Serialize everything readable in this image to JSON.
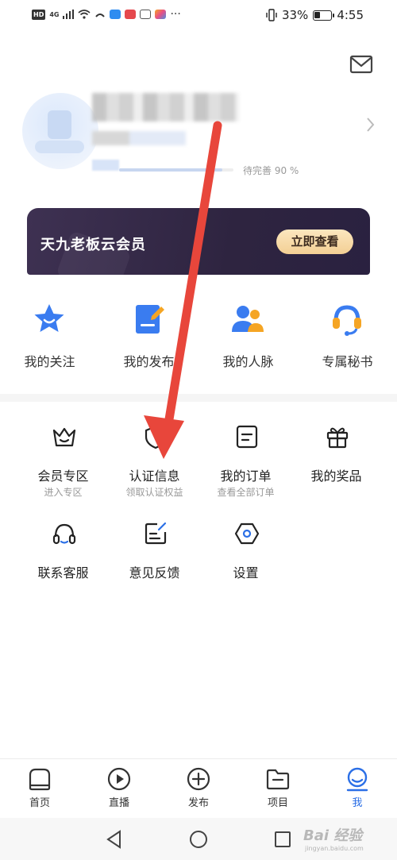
{
  "status_bar": {
    "left_chip": "HD",
    "network": "4G",
    "dots": "···",
    "battery_percent": "33%",
    "battery_level": 0.33,
    "time": "4:55"
  },
  "profile": {
    "progress_text": "待完善 90 %",
    "progress_value": 0.9
  },
  "vip_banner": {
    "title": "天九老板云会员",
    "button_label": "立即查看"
  },
  "quick_actions": [
    {
      "label": "我的关注",
      "icon": "star-icon"
    },
    {
      "label": "我的发布",
      "icon": "document-edit-icon"
    },
    {
      "label": "我的人脉",
      "icon": "people-icon"
    },
    {
      "label": "专属秘书",
      "icon": "headset-icon"
    }
  ],
  "services": [
    {
      "label": "会员专区",
      "sub": "进入专区",
      "icon": "crown-icon"
    },
    {
      "label": "认证信息",
      "sub": "领取认证权益",
      "icon": "shield-icon"
    },
    {
      "label": "我的订单",
      "sub": "查看全部订单",
      "icon": "order-icon"
    },
    {
      "label": "我的奖品",
      "sub": "",
      "icon": "gift-icon"
    },
    {
      "label": "联系客服",
      "sub": "",
      "icon": "headphones-icon"
    },
    {
      "label": "意见反馈",
      "sub": "",
      "icon": "feedback-icon"
    },
    {
      "label": "设置",
      "sub": "",
      "icon": "settings-icon"
    }
  ],
  "tabs": [
    {
      "label": "首页",
      "icon": "home-icon",
      "active": false
    },
    {
      "label": "直播",
      "icon": "play-icon",
      "active": false
    },
    {
      "label": "发布",
      "icon": "plus-circle-icon",
      "active": false
    },
    {
      "label": "项目",
      "icon": "folder-icon",
      "active": false
    },
    {
      "label": "我",
      "icon": "user-icon",
      "active": true
    }
  ],
  "watermark": {
    "text": "Bai 经验",
    "sub": "jingyan.baidu.com"
  },
  "colors": {
    "accent": "#2b6fe6",
    "arrow": "#e8463b",
    "vip_dark": "#2e2440",
    "vip_gold": "#f3cf94"
  }
}
